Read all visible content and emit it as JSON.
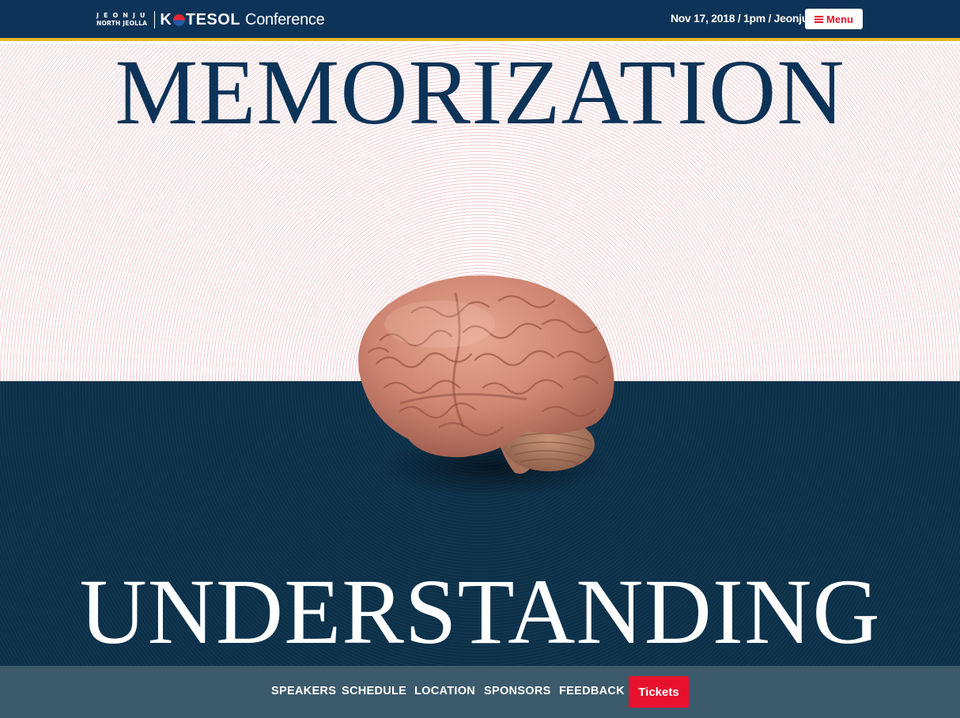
{
  "header": {
    "logo": {
      "city": "JEONJU",
      "province": "NORTH JEOLLA",
      "brand_k": "K",
      "brand_rest": "TESOL",
      "brand_suffix": "Conference"
    },
    "event_date_time": "Nov 17, 2018 / 1pm / ",
    "event_city": "Jeonju",
    "menu_label": "Menu"
  },
  "hero": {
    "headline_top": "MEMORIZATION",
    "headline_bottom": "UNDERSTANDING",
    "image": "brain-illustration"
  },
  "nav": {
    "items": [
      {
        "label": "SPEAKERS"
      },
      {
        "label": "SCHEDULE"
      },
      {
        "label": "LOCATION"
      },
      {
        "label": "SPONSORS"
      },
      {
        "label": "FEEDBACK"
      }
    ],
    "tickets_label": "Tickets"
  },
  "colors": {
    "header_navy": "#0e3358",
    "accent_gold": "#e8b823",
    "accent_red": "#e8112d",
    "hero_dark": "#0d3049",
    "nav_bar": "#3b5a6c"
  }
}
